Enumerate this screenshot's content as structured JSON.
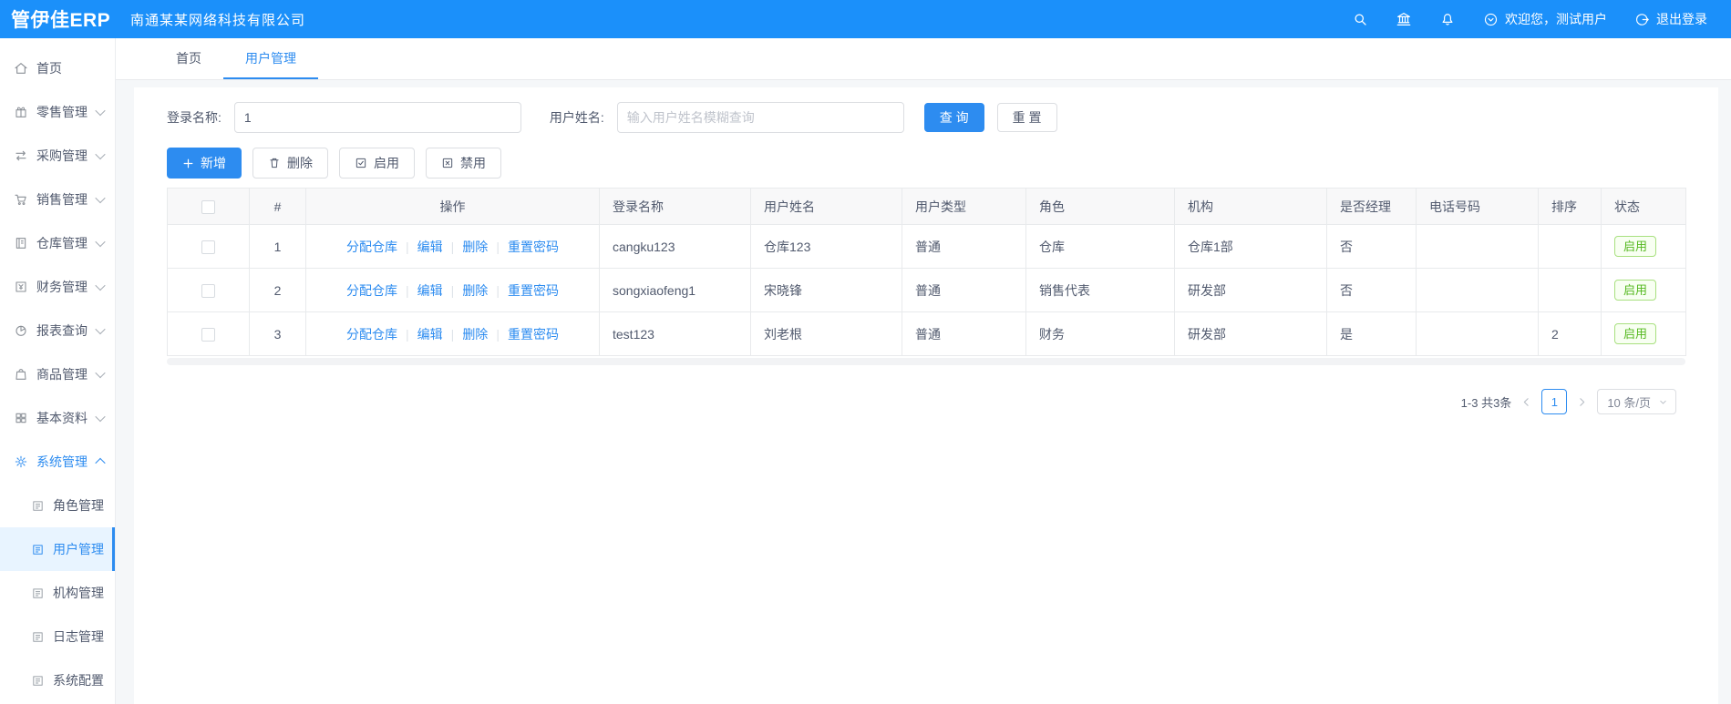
{
  "app": {
    "title": "管伊佳ERP",
    "company": "南通某某网络科技有限公司"
  },
  "topbar": {
    "welcome": "欢迎您，测试用户",
    "logout": "退出登录"
  },
  "icons": {
    "topbar": [
      "search",
      "bank-building",
      "bell",
      "chevron-circle-down",
      "logout-power"
    ],
    "sidebar": [
      "home",
      "gift",
      "swap-arrows",
      "cart",
      "ledger",
      "finance-box",
      "pie-chart",
      "shopping-bag",
      "grid",
      "gear",
      "document"
    ],
    "toolbar": [
      "plus",
      "trash",
      "check-square",
      "x-square"
    ]
  },
  "sidebar": {
    "items": [
      {
        "label": "首页",
        "icon": "home",
        "chevron": ""
      },
      {
        "label": "零售管理",
        "icon": "gift",
        "chevron": "down"
      },
      {
        "label": "采购管理",
        "icon": "swap-arrows",
        "chevron": "down"
      },
      {
        "label": "销售管理",
        "icon": "cart",
        "chevron": "down"
      },
      {
        "label": "仓库管理",
        "icon": "ledger",
        "chevron": "down"
      },
      {
        "label": "财务管理",
        "icon": "finance-box",
        "chevron": "down"
      },
      {
        "label": "报表查询",
        "icon": "pie-chart",
        "chevron": "down"
      },
      {
        "label": "商品管理",
        "icon": "shopping-bag",
        "chevron": "down"
      },
      {
        "label": "基本资料",
        "icon": "grid",
        "chevron": "down"
      },
      {
        "label": "系统管理",
        "icon": "gear",
        "chevron": "up",
        "active": true
      }
    ],
    "subitems": [
      {
        "label": "角色管理",
        "icon": "document"
      },
      {
        "label": "用户管理",
        "icon": "document",
        "active": true
      },
      {
        "label": "机构管理",
        "icon": "document"
      },
      {
        "label": "日志管理",
        "icon": "document"
      },
      {
        "label": "系统配置",
        "icon": "document"
      }
    ]
  },
  "tabs": [
    {
      "label": "首页"
    },
    {
      "label": "用户管理",
      "active": true
    }
  ],
  "filters": {
    "login_label": "登录名称:",
    "login_value": "1",
    "name_label": "用户姓名:",
    "name_placeholder": "输入用户姓名模糊查询",
    "search": "查 询",
    "reset": "重 置"
  },
  "toolbar": {
    "add": "新增",
    "delete": "删除",
    "enable": "启用",
    "disable": "禁用"
  },
  "table": {
    "headers": [
      "#",
      "操作",
      "登录名称",
      "用户姓名",
      "用户类型",
      "角色",
      "机构",
      "是否经理",
      "电话号码",
      "排序",
      "状态"
    ],
    "row_actions": [
      "分配仓库",
      "编辑",
      "删除",
      "重置密码"
    ],
    "rows": [
      {
        "index": "1",
        "login": "cangku123",
        "name": "仓库123",
        "type": "普通",
        "role": "仓库",
        "org": "仓库1部",
        "manager": "否",
        "phone": "",
        "sort": "",
        "status": "启用"
      },
      {
        "index": "2",
        "login": "songxiaofeng1",
        "name": "宋晓锋",
        "type": "普通",
        "role": "销售代表",
        "org": "研发部",
        "manager": "否",
        "phone": "",
        "sort": "",
        "status": "启用"
      },
      {
        "index": "3",
        "login": "test123",
        "name": "刘老根",
        "type": "普通",
        "role": "财务",
        "org": "研发部",
        "manager": "是",
        "phone": "",
        "sort": "2",
        "status": "启用"
      }
    ]
  },
  "pagination": {
    "total": "1-3 共3条",
    "page": "1",
    "page_size": "10 条/页"
  },
  "colors": {
    "topbar": "#1b90fa",
    "primary": "#2d8cf0",
    "link": "#2d8cf0",
    "success_text": "#54b81e",
    "success_border": "#a8e07f",
    "active_bg": "#e8f4ff"
  }
}
